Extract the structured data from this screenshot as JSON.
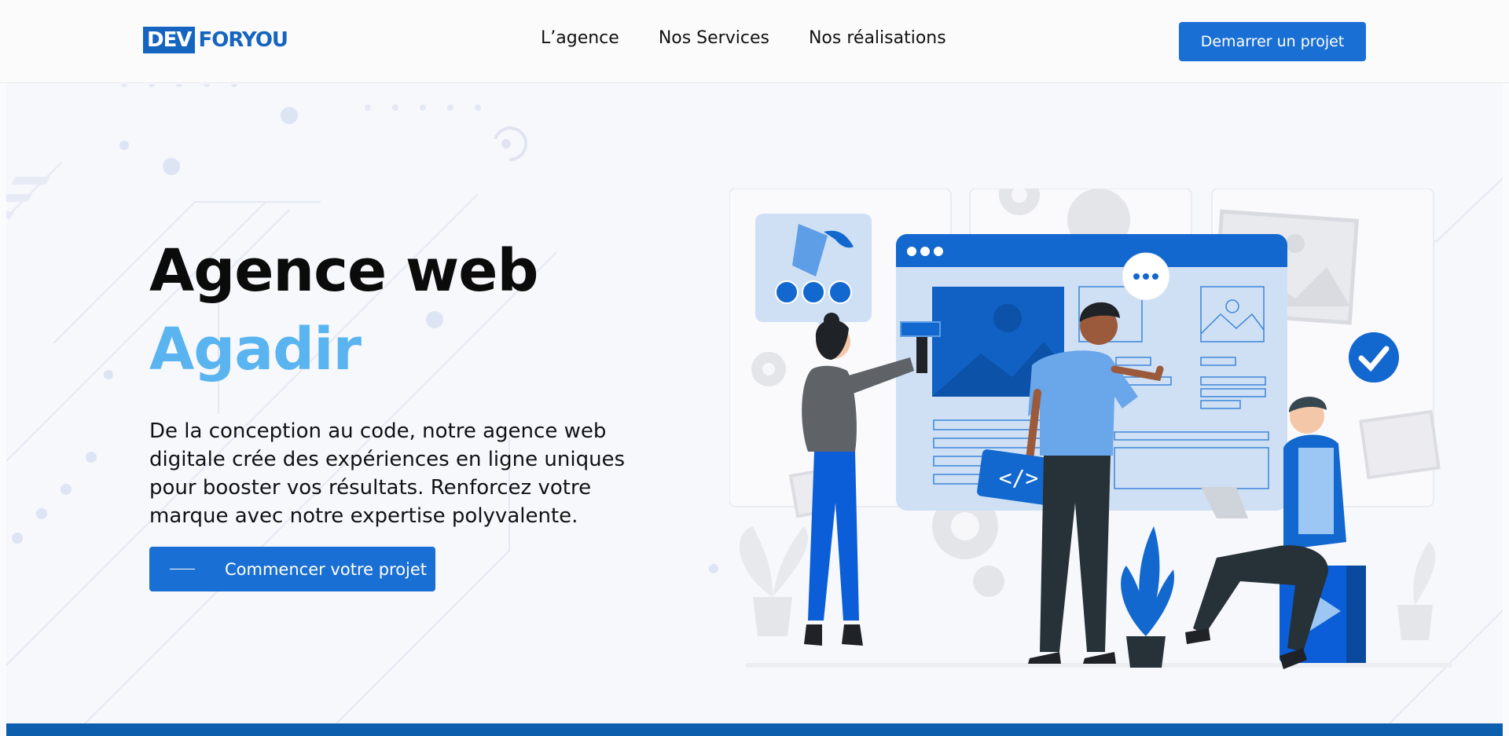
{
  "header": {
    "logo": {
      "part1": "DEV",
      "part2": "FORYOU"
    },
    "nav": [
      {
        "label": "L’agence"
      },
      {
        "label": "Nos Services"
      },
      {
        "label": "Nos réalisations"
      }
    ],
    "cta_label": "Demarrer un projet"
  },
  "hero": {
    "title_line1": "Agence web",
    "title_line2": "Agadir",
    "description": "De la conception au code, notre agence web digitale crée des expériences en ligne uniques pour booster vos résultats. Renforcez votre marque avec notre expertise polyvalente.",
    "cta_label": "Commencer votre projet"
  },
  "colors": {
    "accent": "#1a6fd4",
    "title_highlight": "#5ab4f0",
    "footer_bar": "#0d5fae",
    "logo_blue": "#1565c0"
  },
  "illustration": {
    "icons": [
      "paint-bucket-icon",
      "code-icon",
      "play-icon",
      "check-icon",
      "chat-dots-icon",
      "gear-icon"
    ]
  }
}
